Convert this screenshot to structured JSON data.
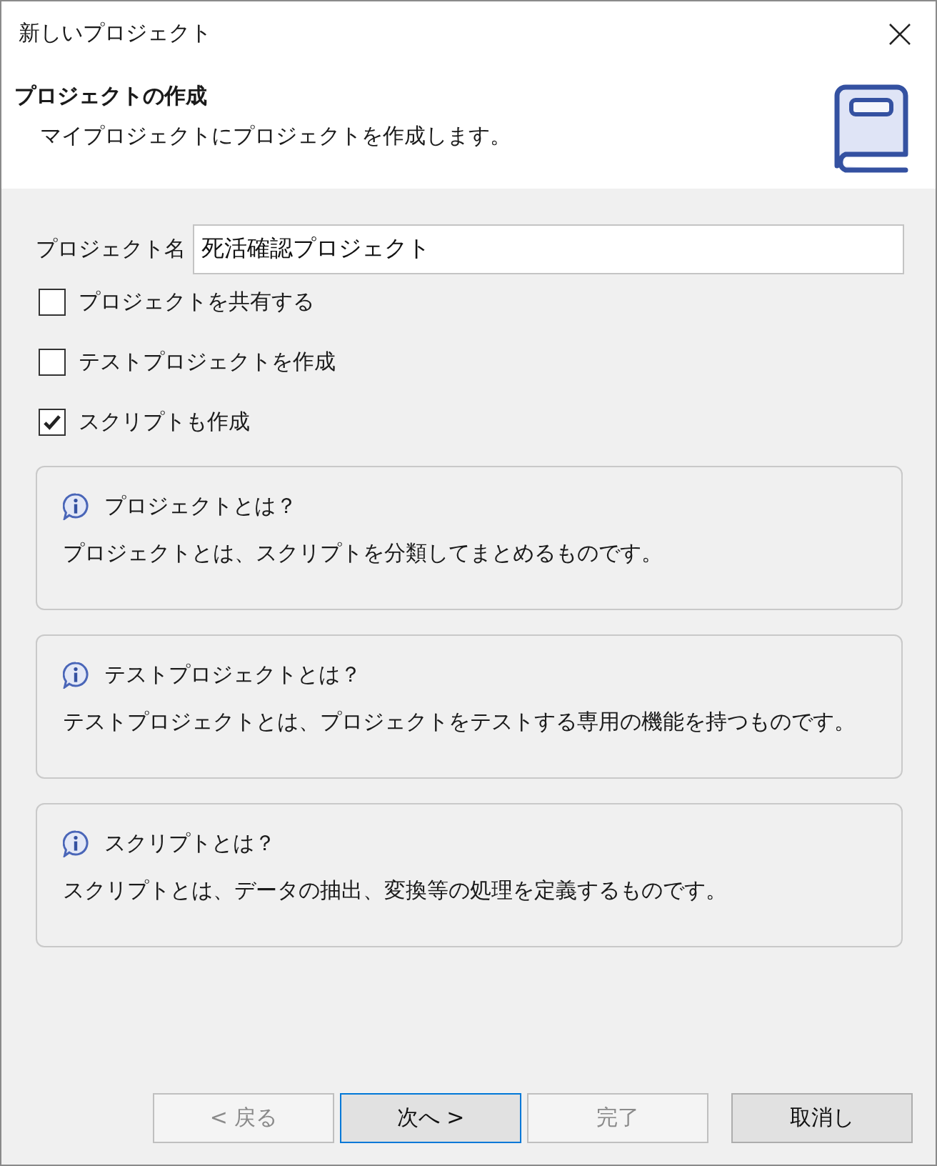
{
  "window": {
    "title": "新しいプロジェクト"
  },
  "header": {
    "title": "プロジェクトの作成",
    "subtitle": "マイプロジェクトにプロジェクトを作成します。"
  },
  "form": {
    "name_field": {
      "label": "プロジェクト名",
      "value": "死活確認プロジェクト"
    },
    "checkboxes": [
      {
        "label": "プロジェクトを共有する",
        "checked": false
      },
      {
        "label": "テストプロジェクトを作成",
        "checked": false
      },
      {
        "label": "スクリプトも作成",
        "checked": true
      }
    ]
  },
  "info_panels": [
    {
      "title": "プロジェクトとは？",
      "text": "プロジェクトとは、スクリプトを分類してまとめるものです。"
    },
    {
      "title": "テストプロジェクトとは？",
      "text": "テストプロジェクトとは、プロジェクトをテストする専用の機能を持つものです。"
    },
    {
      "title": "スクリプトとは？",
      "text": "スクリプトとは、データの抽出、変換等の処理を定義するものです。"
    }
  ],
  "buttons": [
    {
      "label": "< 戻る",
      "disabled": true,
      "focused": false
    },
    {
      "label": "次へ >",
      "disabled": false,
      "focused": true
    },
    {
      "label": "完了",
      "disabled": true,
      "focused": false
    },
    {
      "label": "取消し",
      "disabled": false,
      "focused": false
    }
  ]
}
